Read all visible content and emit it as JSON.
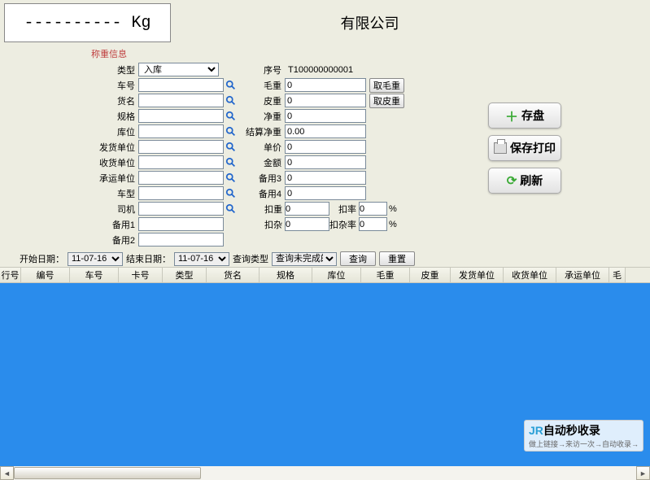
{
  "header": {
    "weight_display": "---------- Kg",
    "company": "有限公司"
  },
  "section_title": "称重信息",
  "left": {
    "type_label": "类型",
    "type_value": "入库",
    "car_no_label": "车号",
    "car_no": "",
    "goods_label": "货名",
    "goods": "",
    "spec_label": "规格",
    "spec": "",
    "store_label": "库位",
    "store": "",
    "ship_unit_label": "发货单位",
    "ship_unit": "",
    "recv_unit_label": "收货单位",
    "recv_unit": "",
    "carrier_label": "承运单位",
    "carrier": "",
    "car_type_label": "车型",
    "car_type": "",
    "driver_label": "司机",
    "driver": "",
    "spare1_label": "备用1",
    "spare1": "",
    "spare2_label": "备用2",
    "spare2": ""
  },
  "mid": {
    "seq_label": "序号",
    "seq_value": "T100000000001",
    "gross_label": "毛重",
    "gross": "0",
    "gross_btn": "取毛重",
    "tare_label": "皮重",
    "tare": "0",
    "tare_btn": "取皮重",
    "net_label": "净重",
    "net": "0",
    "settle_label": "结算净重",
    "settle": "0.00",
    "price_label": "单价",
    "price": "0",
    "amount_label": "金额",
    "amount": "0",
    "spare3_label": "备用3",
    "spare3": "0",
    "spare4_label": "备用4",
    "spare4": "0",
    "deduct_w_label": "扣重",
    "deduct_w": "0",
    "deduct_rate_label": "扣率",
    "deduct_rate": "0",
    "pct": "%",
    "deduct_misc_label": "扣杂",
    "deduct_misc": "0",
    "deduct_misc_rate_label": "扣杂率",
    "deduct_misc_rate": "0"
  },
  "buttons": {
    "save": "存盘",
    "save_print": "保存打印",
    "refresh": "刷新"
  },
  "query": {
    "start_label": "开始日期：",
    "start_date": "11-07-16",
    "end_label": "结束日期：",
    "end_date": "11-07-16",
    "type_label": "查询类型",
    "type_value": "查询未完成的记录",
    "query_btn": "查询",
    "reset_btn": "重置"
  },
  "grid_headers": [
    "行号",
    "编号",
    "车号",
    "卡号",
    "类型",
    "货名",
    "规格",
    "库位",
    "毛重",
    "皮重",
    "发货单位",
    "收货单位",
    "承运单位",
    "毛"
  ],
  "grid_widths": [
    26,
    60,
    60,
    54,
    54,
    65,
    65,
    60,
    60,
    50,
    65,
    65,
    65,
    20
  ],
  "watermark": {
    "logo": "JR",
    "title": "自动秒收录",
    "sub": "做上链接→来访一次→自动收录→"
  }
}
